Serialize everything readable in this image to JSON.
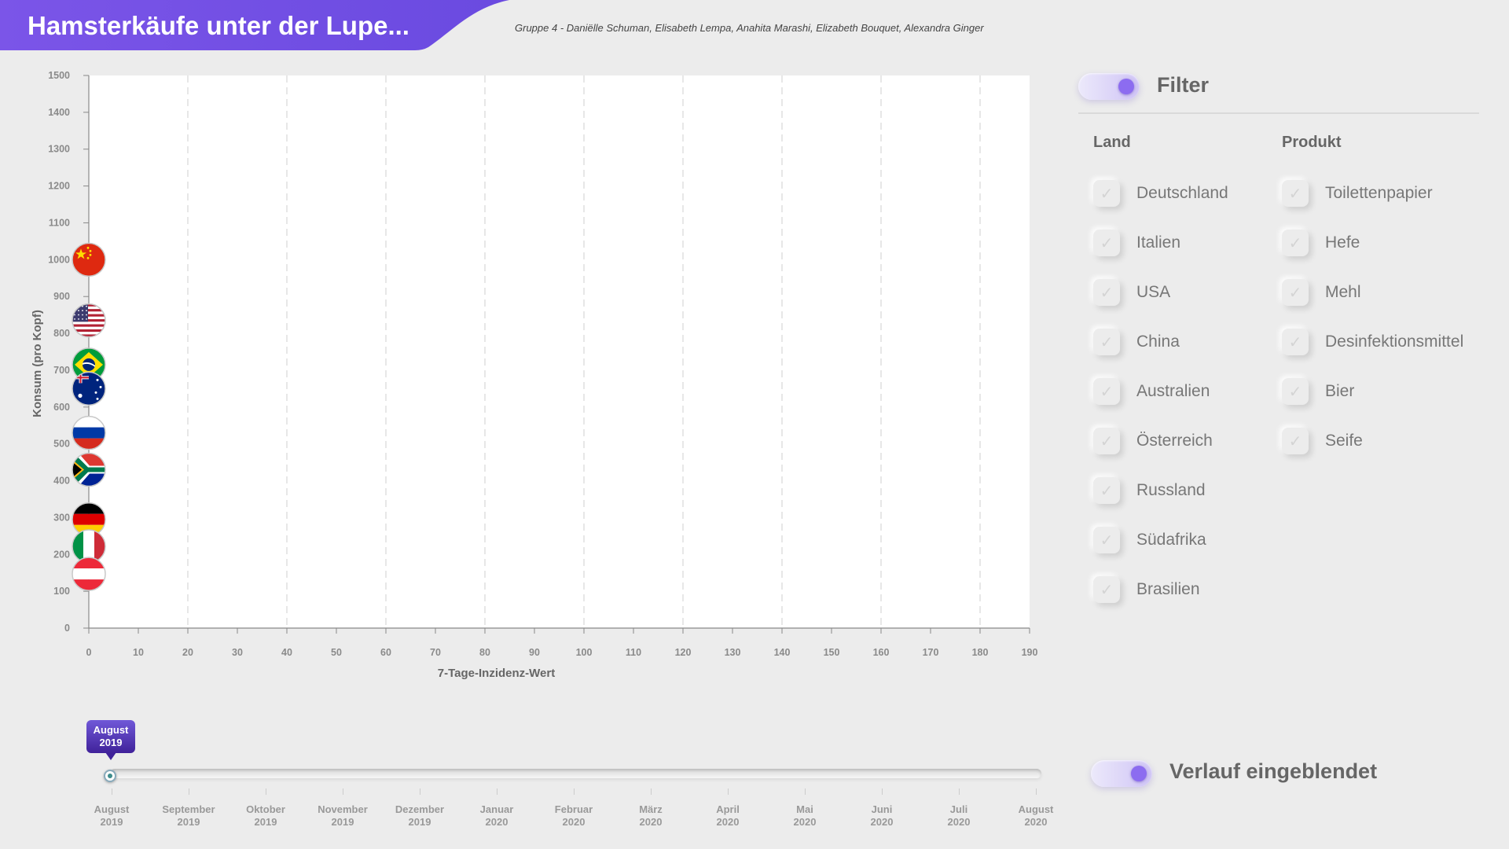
{
  "header": {
    "title": "Hamsterkäufe unter der Lupe...",
    "authors": "Gruppe 4 - Daniëlle Schuman, Elisabeth Lempa, Anahita Marashi, Elizabeth Bouquet, Alexandra Ginger",
    "accent": "#7b55e8"
  },
  "chart_data": {
    "type": "scatter",
    "xlabel": "7-Tage-Inzidenz-Wert",
    "ylabel": "Konsum (pro Kopf)",
    "xlim": [
      0,
      190
    ],
    "ylim": [
      0,
      1500
    ],
    "x_ticks": [
      0,
      10,
      20,
      30,
      40,
      50,
      60,
      70,
      80,
      90,
      100,
      110,
      120,
      130,
      140,
      150,
      160,
      170,
      180,
      190
    ],
    "y_ticks": [
      0,
      100,
      200,
      300,
      400,
      500,
      600,
      700,
      800,
      900,
      1000,
      1100,
      1200,
      1300,
      1400,
      1500
    ],
    "x_gridlines": [
      20,
      40,
      60,
      80,
      100,
      120,
      140,
      160,
      180
    ],
    "grid": "vertical dashed",
    "marker": "country flag",
    "points": [
      {
        "flag": "china-flag",
        "x": 0,
        "y": 1000
      },
      {
        "flag": "usa-flag",
        "x": 0,
        "y": 835
      },
      {
        "flag": "brazil-flag",
        "x": 0,
        "y": 715
      },
      {
        "flag": "australia-flag",
        "x": 0,
        "y": 650
      },
      {
        "flag": "russia-flag",
        "x": 0,
        "y": 530
      },
      {
        "flag": "south-africa-flag",
        "x": 0,
        "y": 430
      },
      {
        "flag": "germany-flag",
        "x": 0,
        "y": 295
      },
      {
        "flag": "italy-flag",
        "x": 0,
        "y": 222
      },
      {
        "flag": "austria-flag",
        "x": 0,
        "y": 147
      }
    ]
  },
  "filter": {
    "title": "Filter",
    "toggle_on": true,
    "land_title": "Land",
    "produkt_title": "Produkt",
    "countries": [
      "Deutschland",
      "Italien",
      "USA",
      "China",
      "Australien",
      "Österreich",
      "Russland",
      "Südafrika",
      "Brasilien"
    ],
    "products": [
      "Toilettenpapier",
      "Hefe",
      "Mehl",
      "Desinfektionsmittel",
      "Bier",
      "Seife"
    ],
    "check_glyph": "✓"
  },
  "verlauf": {
    "label": "Verlauf eingeblendet",
    "toggle_on": true
  },
  "timeline": {
    "selected": [
      "August",
      "2019"
    ],
    "months": [
      [
        "August",
        "2019"
      ],
      [
        "September",
        "2019"
      ],
      [
        "Oktober",
        "2019"
      ],
      [
        "November",
        "2019"
      ],
      [
        "Dezember",
        "2019"
      ],
      [
        "Januar",
        "2020"
      ],
      [
        "Februar",
        "2020"
      ],
      [
        "März",
        "2020"
      ],
      [
        "April",
        "2020"
      ],
      [
        "Mai",
        "2020"
      ],
      [
        "Juni",
        "2020"
      ],
      [
        "Juli",
        "2020"
      ],
      [
        "August",
        "2020"
      ]
    ]
  }
}
